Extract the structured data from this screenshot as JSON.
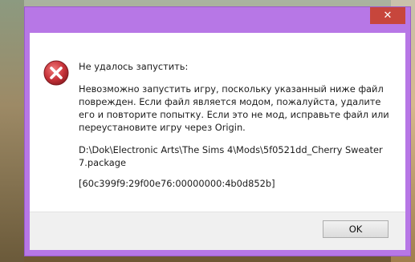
{
  "dialog": {
    "close_glyph": "✕",
    "title": "Не удалось запустить:",
    "message": "Невозможно запустить игру, поскольку указанный ниже файл поврежден. Если файл является модом, пожалуйста, удалите его и повторите попытку. Если это не мод, исправьте файл или переустановите игру через Origin.",
    "file_path": "D:\\Dok\\Electronic Arts\\The Sims 4\\Mods\\5f0521dd_Cherry Sweater7.package",
    "error_code": "[60c399f9:29f00e76:00000000:4b0d852b]",
    "ok_label": "OK"
  },
  "colors": {
    "frame": "#b777e6",
    "close": "#c7463c",
    "error_icon": "#c8333a"
  }
}
